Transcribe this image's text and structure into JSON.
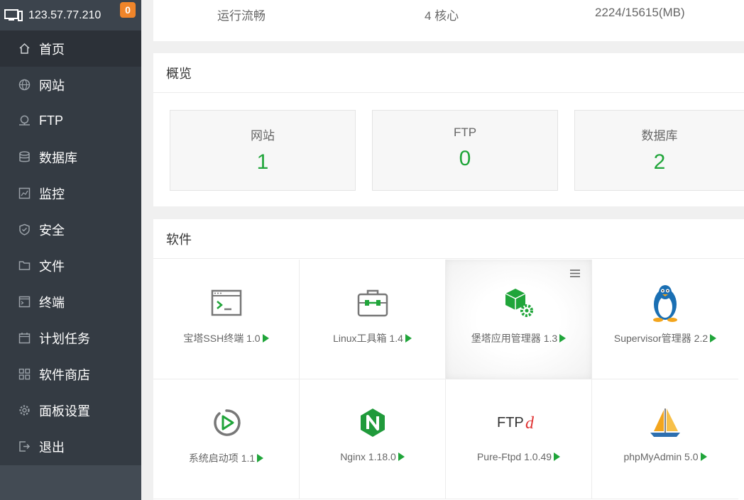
{
  "server": {
    "ip": "123.57.77.210",
    "badge": "0"
  },
  "sidebar": {
    "items": [
      {
        "label": "首页",
        "icon": "home-icon"
      },
      {
        "label": "网站",
        "icon": "globe-icon"
      },
      {
        "label": "FTP",
        "icon": "ftp-icon"
      },
      {
        "label": "数据库",
        "icon": "database-icon"
      },
      {
        "label": "监控",
        "icon": "monitor-icon"
      },
      {
        "label": "安全",
        "icon": "shield-icon"
      },
      {
        "label": "文件",
        "icon": "folder-icon"
      },
      {
        "label": "终端",
        "icon": "terminal-icon"
      },
      {
        "label": "计划任务",
        "icon": "calendar-icon"
      },
      {
        "label": "软件商店",
        "icon": "apps-icon"
      },
      {
        "label": "面板设置",
        "icon": "gear-icon"
      },
      {
        "label": "退出",
        "icon": "logout-icon"
      }
    ]
  },
  "status": {
    "load": "运行流畅",
    "cpu": "4 核心",
    "memory": "2224/15615(MB)"
  },
  "overview": {
    "title": "概览",
    "cards": [
      {
        "label": "网站",
        "value": "1"
      },
      {
        "label": "FTP",
        "value": "0"
      },
      {
        "label": "数据库",
        "value": "2"
      }
    ]
  },
  "software": {
    "title": "软件",
    "items": [
      {
        "name": "宝塔SSH终端 1.0",
        "icon": "ssh-terminal-icon"
      },
      {
        "name": "Linux工具箱 1.4",
        "icon": "toolbox-icon"
      },
      {
        "name": "堡塔应用管理器 1.3",
        "icon": "app-manager-icon"
      },
      {
        "name": "Supervisor管理器 2.2",
        "icon": "penguin-icon"
      },
      {
        "name": "系统启动项 1.1",
        "icon": "startup-icon"
      },
      {
        "name": "Nginx 1.18.0",
        "icon": "nginx-icon"
      },
      {
        "name": "Pure-Ftpd 1.0.49",
        "icon": "ftpd-icon"
      },
      {
        "name": "phpMyAdmin 5.0",
        "icon": "phpmyadmin-icon"
      }
    ]
  },
  "colors": {
    "accent": "#20a53a",
    "sidebar": "#3c444d",
    "badge": "#f0852a"
  }
}
